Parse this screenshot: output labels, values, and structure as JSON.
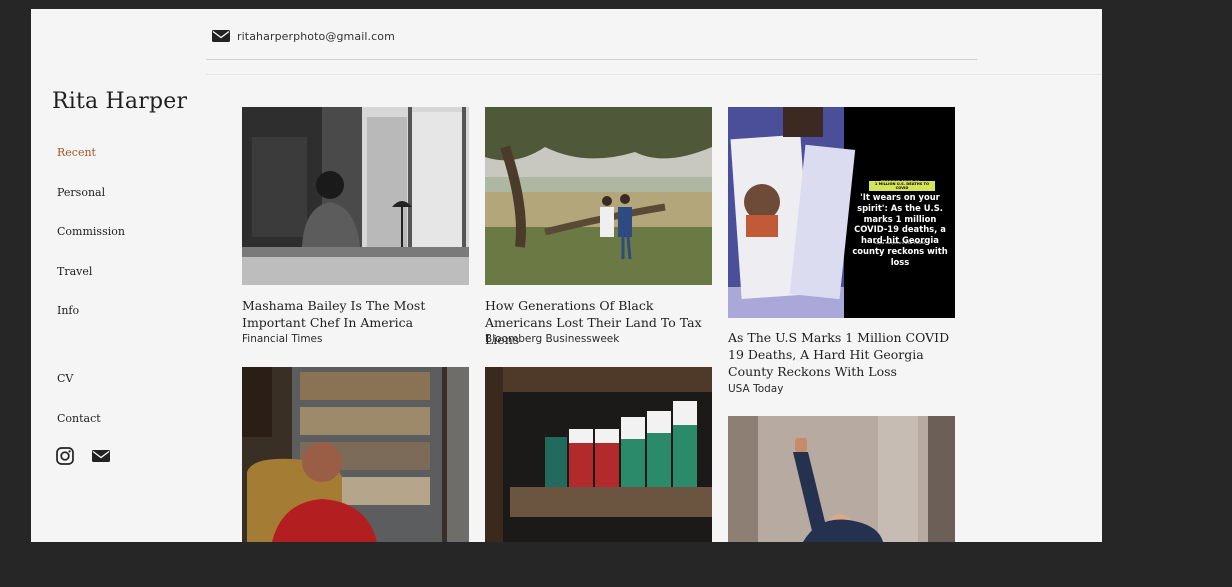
{
  "header": {
    "email": "ritaharperphoto@gmail.com"
  },
  "site": {
    "name": "Rita Harper"
  },
  "nav": {
    "items": [
      {
        "label": "Recent",
        "active": true
      },
      {
        "label": "Personal"
      },
      {
        "label": "Commission"
      },
      {
        "label": "Travel"
      },
      {
        "label": "Info"
      },
      {
        "label": "CV"
      },
      {
        "label": "Contact"
      }
    ]
  },
  "social": {
    "icons": [
      "instagram-icon",
      "envelope-icon"
    ]
  },
  "colors": {
    "accent": "#a0572a",
    "page_bg": "#f6f5f6",
    "backdrop": "#262626"
  },
  "gallery": [
    {
      "title": "Mashama Bailey Is The Most Important Chef In America",
      "publication": "Financial Times"
    },
    {
      "title": "How Generations Of Black Americans Lost Their Land To Tax Liens",
      "publication": "Bloomberg Businessweek"
    },
    {
      "title": "As The U.S Marks 1 Million COVID 19 Deaths, A Hard Hit Georgia County Reckons With Loss",
      "publication": "USA Today",
      "image_text": {
        "kicker": "GROWING COVID-19",
        "badge": "1 MILLION U.S. DEATHS TO COVID",
        "headline": "'It wears on your spirit': As the U.S. marks 1 million COVID-19 deaths, a hard-hit Georgia county reckons with loss",
        "byline": "Kayla Konyecsni USA TODAY"
      }
    },
    {
      "title": "",
      "publication": ""
    },
    {
      "title": "",
      "publication": ""
    },
    {
      "title": "",
      "publication": ""
    }
  ]
}
